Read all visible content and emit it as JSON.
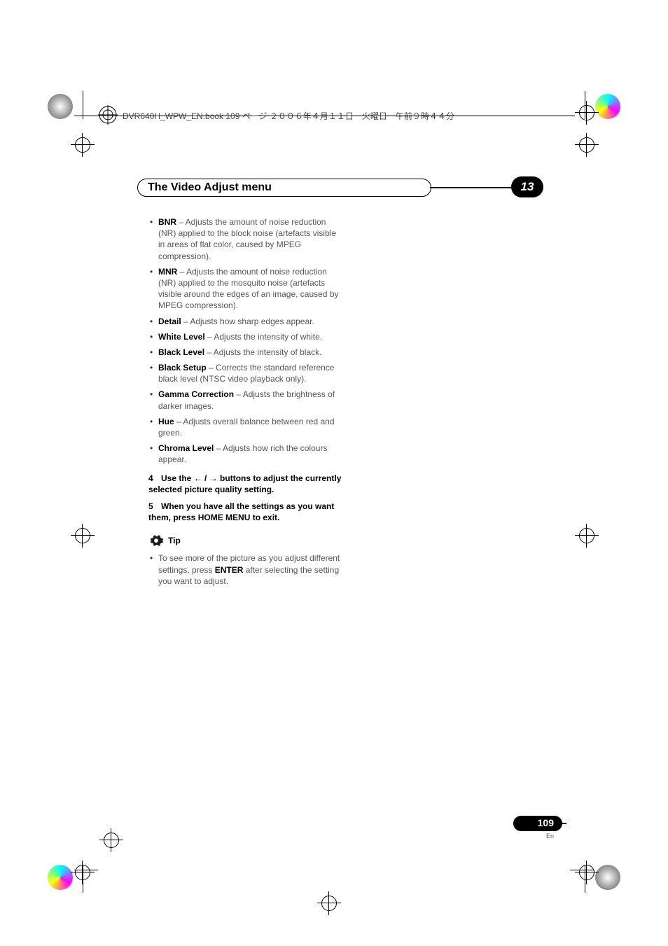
{
  "header": {
    "file_info": "DVR640H_WPW_EN.book  109 ページ  ２００６年４月１１日　火曜日　午前９時４４分"
  },
  "chapter": {
    "title": "The Video Adjust menu",
    "number": "13"
  },
  "items": {
    "bnr_label": "BNR",
    "bnr_text": " – Adjusts the amount of noise reduction (NR) applied to the block noise (artefacts visible in areas of flat color, caused by MPEG compression).",
    "mnr_label": "MNR",
    "mnr_text": " – Adjusts the amount of noise reduction (NR) applied to the mosquito noise (artefacts visible around the edges of an image, caused by MPEG compression).",
    "detail_label": "Detail",
    "detail_text": " – Adjusts how sharp edges appear.",
    "white_label": "White Level",
    "white_text": " – Adjusts the intensity of white.",
    "black_label": "Black Level",
    "black_text": " – Adjusts the intensity of black.",
    "setup_label": "Black Setup",
    "setup_text": " – Corrects the standard reference black level (NTSC video playback only).",
    "gamma_label": "Gamma Correction",
    "gamma_text": " – Adjusts the brightness of darker images.",
    "hue_label": "Hue",
    "hue_text": " – Adjusts overall balance between red and green.",
    "chroma_label": "Chroma Level",
    "chroma_text": " – Adjusts how rich the colours appear."
  },
  "steps": {
    "s4_num": "4",
    "s4_a": "Use the ",
    "s4_arrows": "← / →",
    "s4_b": " buttons to adjust the currently selected picture quality setting.",
    "s5_num": "5",
    "s5_text": "When you have all the settings as you want them, press HOME MENU to exit."
  },
  "tip": {
    "label": "Tip",
    "text_a": "To see more of the picture as you adjust different settings, press ",
    "text_b": "ENTER",
    "text_c": " after selecting the setting you want to adjust."
  },
  "footer": {
    "page": "109",
    "lang": "En"
  }
}
